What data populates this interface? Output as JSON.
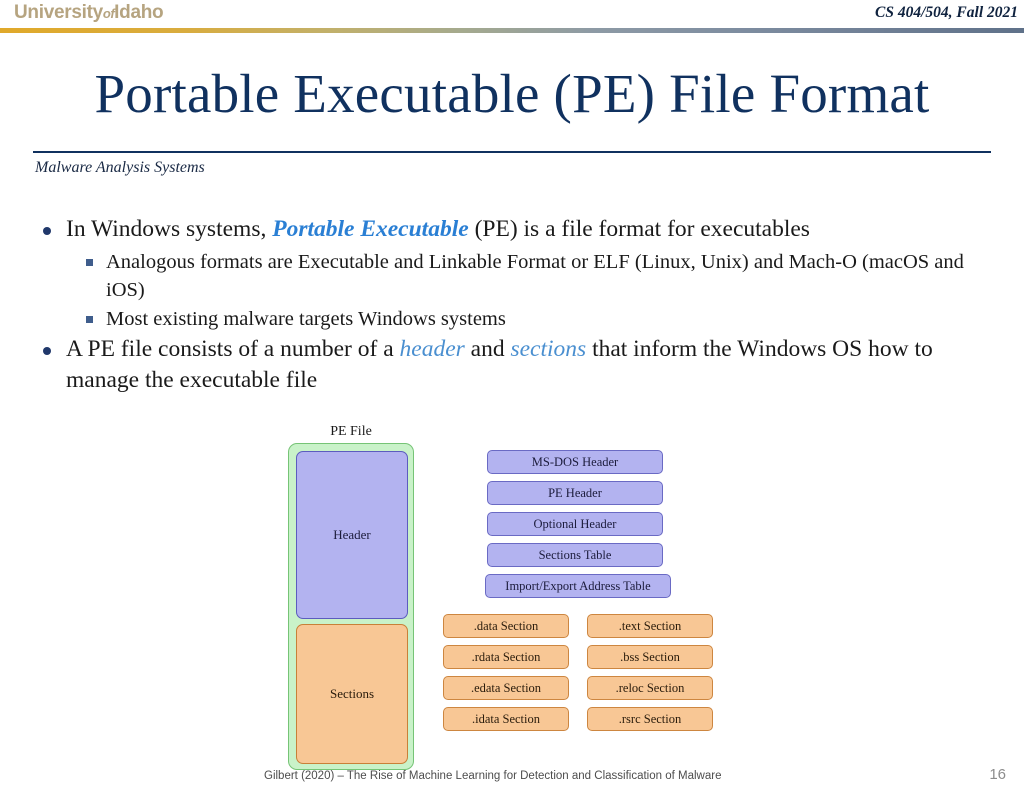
{
  "header": {
    "logo_main_1": "University",
    "logo_of": "of",
    "logo_main_2": "Idaho",
    "course": "CS 404/504, Fall 2021"
  },
  "title": "Portable Executable (PE) File Format",
  "subtitle": "Malware Analysis Systems",
  "bullets": [
    {
      "level": 1,
      "segments": [
        {
          "text": "In Windows systems, ",
          "style": "plain"
        },
        {
          "text": "Portable Executable",
          "style": "strong"
        },
        {
          "text": " (PE) is a file format for executables",
          "style": "plain"
        }
      ]
    },
    {
      "level": 2,
      "segments": [
        {
          "text": "Analogous formats are Executable and Linkable Format or ELF (Linux, Unix) and Mach-O (macOS and iOS)",
          "style": "plain"
        }
      ]
    },
    {
      "level": 2,
      "segments": [
        {
          "text": "Most existing malware targets Windows systems",
          "style": "plain"
        }
      ]
    },
    {
      "level": 1,
      "segments": [
        {
          "text": "A PE file consists of a number of a ",
          "style": "plain"
        },
        {
          "text": "header",
          "style": "soft"
        },
        {
          "text": " and ",
          "style": "plain"
        },
        {
          "text": "sections",
          "style": "soft"
        },
        {
          "text": " that inform the Windows OS how to manage the executable file",
          "style": "plain"
        }
      ]
    }
  ],
  "diagram": {
    "pe_file_label": "PE File",
    "header_block_label": "Header",
    "sections_block_label": "Sections",
    "header_items": [
      "MS-DOS Header",
      "PE Header",
      "Optional Header",
      "Sections Table",
      "Import/Export Address Table"
    ],
    "section_items_left": [
      ".data Section",
      ".rdata Section",
      ".edata Section",
      ".idata Section"
    ],
    "section_items_right": [
      ".text Section",
      ".bss Section",
      ".reloc Section",
      ".rsrc Section"
    ],
    "colors": {
      "container_fill": "#c9f2c9",
      "container_border": "#76c476",
      "header_fill": "#b3b3f0",
      "header_border": "#5c5cbf",
      "section_fill": "#f8c795",
      "section_border": "#c88038"
    }
  },
  "footer": {
    "citation": "Gilbert (2020) – The Rise of Machine Learning for Detection and Classification of Malware",
    "slide_number": "16"
  },
  "theme": {
    "title_color": "#10315f",
    "logo_color": "#b6a480",
    "accent_blue": "#2a7fd4"
  }
}
